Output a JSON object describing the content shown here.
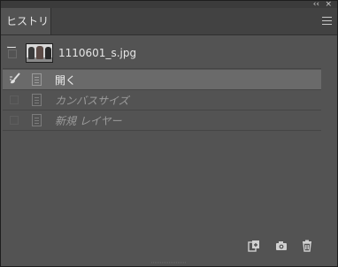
{
  "panel": {
    "tab_label": "ヒストリー",
    "collapse_glyph": "‹‹",
    "close_glyph": "×"
  },
  "snapshot": {
    "label": "1110601_s.jpg"
  },
  "history": {
    "items": [
      {
        "label": "開く",
        "state": "active"
      },
      {
        "label": "カンバスサイズ",
        "state": "undone"
      },
      {
        "label": "新規 レイヤー",
        "state": "undone"
      }
    ]
  },
  "footer": {
    "buttons": [
      "new-document-from-state-icon",
      "camera-icon",
      "trash-icon"
    ]
  },
  "colors": {
    "panel_bg": "#535353",
    "active_row": "#6a6a6a",
    "tab_bar": "#424242"
  }
}
